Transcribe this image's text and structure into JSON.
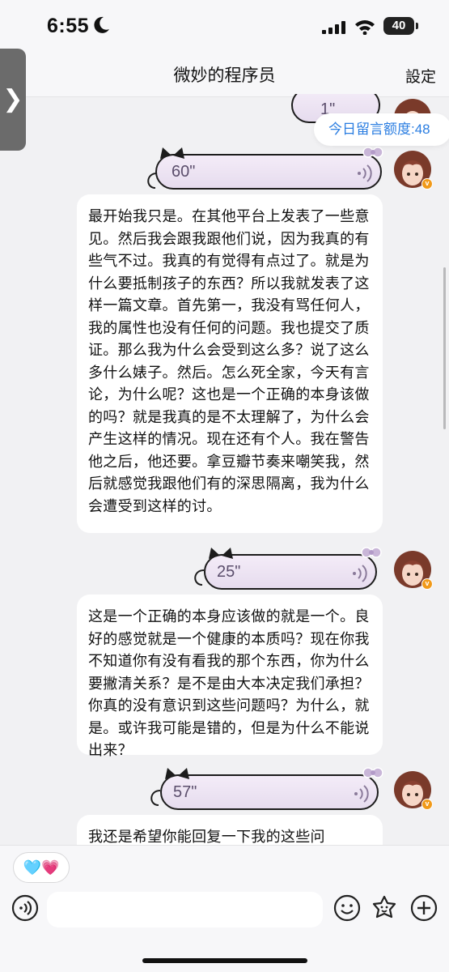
{
  "status_bar": {
    "time": "6:55",
    "battery": "40"
  },
  "nav": {
    "title": "微妙的程序员",
    "settings": "設定",
    "back_tab": "❯"
  },
  "quota": {
    "label": "今日留言额度:48"
  },
  "voice_messages": [
    {
      "duration": "1\""
    },
    {
      "duration": "60\""
    },
    {
      "duration": "25\""
    },
    {
      "duration": "57\""
    }
  ],
  "text_messages": [
    {
      "text": "最开始我只是。在其他平台上发表了一些意见。然后我会跟我跟他们说，因为我真的有些气不过。我真的有觉得有点过了。就是为什么要抵制孩子的东西？所以我就发表了这样一篇文章。首先第一，我没有骂任何人，我的属性也没有任何的问题。我也提交了质证。那么我为什么会受到这么多？说了这么多什么婊子。然后。怎么死全家，今天有言论，为什么呢？这也是一个正确的本身该做的吗？就是我真的是不太理解了，为什么会产生这样的情况。现在还有个人。我在警告他之后，他还要。拿豆瓣节奏来嘲笑我，然后就感觉我跟他们有的深思隔离，我为什么会遭受到这样的讨。"
    },
    {
      "text": "这是一个正确的本身应该做的就是一个。良好的感觉就是一个健康的本质吗？现在你我不知道你有没有看我的那个东西，你为什么要撇清关系？是不是由大本决定我们承担？你真的没有意识到这些问题吗？为什么，就是。或许我可能是错的，但是为什么不能说出来？"
    },
    {
      "text": "我还是希望你能回复一下我的这些问"
    }
  ],
  "input": {
    "emoji_chip": "🩵💗",
    "placeholder": ""
  },
  "icons": [
    "moon-icon",
    "signal-icon",
    "wifi-icon",
    "voice-toggle-icon",
    "emoji-icon",
    "sticker-icon",
    "plus-icon"
  ],
  "colors": {
    "link_blue": "#2a7de1",
    "bubble_lilac": "#ece2f2",
    "badge_orange": "#f19a1a"
  }
}
